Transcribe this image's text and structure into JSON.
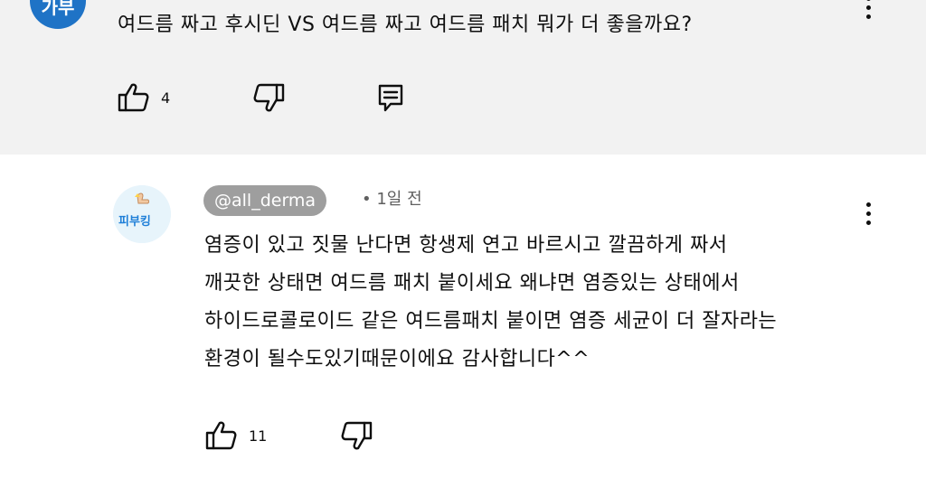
{
  "parent_comment": {
    "avatar_text": "가부",
    "text": "여드름 짜고 후시딘 VS 여드름 짜고 여드름 패치 뭐가 더 좋을까요?",
    "like_count": "4"
  },
  "reply": {
    "author": "@all_derma",
    "meta": "• 1일 전",
    "avatar_text": "피부킹",
    "lines": [
      "염증이 있고 짓물 난다면 항생제 연고 바르시고 깔끔하게 짜서",
      "깨끗한 상태면 여드름 패치 붙이세요 왜냐면 염증있는 상태에서",
      "하이드로콜로이드 같은 여드름패치 붙이면 염증 세균이 더 잘자라는",
      "환경이 될수도있기때문이에요 감사합니다^^"
    ],
    "like_count": "11"
  },
  "icons": [
    "like-icon",
    "dislike-icon",
    "reply-icon",
    "more-icon"
  ],
  "colors": {
    "parent_background": "#f2f2f2",
    "author_chip": "#9e9e9e",
    "avatar_blue": "#1f73c6"
  }
}
